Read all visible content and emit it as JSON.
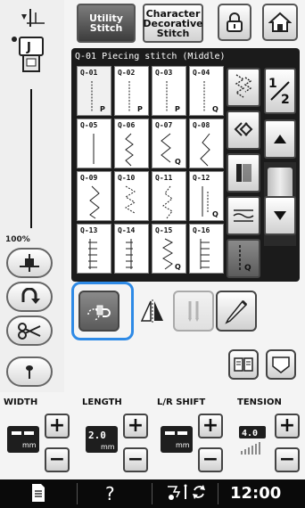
{
  "tabs": {
    "utility": "Utility Stitch",
    "character": "Character Decorative Stitch"
  },
  "panel": {
    "title": "Q-01  Piecing stitch (Middle)"
  },
  "page": {
    "numerator": "1",
    "denominator": "2"
  },
  "stitches": [
    {
      "code": "Q-01",
      "mark": "P"
    },
    {
      "code": "Q-02",
      "mark": "P"
    },
    {
      "code": "Q-03",
      "mark": "P"
    },
    {
      "code": "Q-04",
      "mark": "Q"
    },
    {
      "code": "Q-05",
      "mark": ""
    },
    {
      "code": "Q-06",
      "mark": ""
    },
    {
      "code": "Q-07",
      "mark": "Q"
    },
    {
      "code": "Q-08",
      "mark": ""
    },
    {
      "code": "Q-09",
      "mark": ""
    },
    {
      "code": "Q-10",
      "mark": ""
    },
    {
      "code": "Q-11",
      "mark": ""
    },
    {
      "code": "Q-12",
      "mark": "Q"
    },
    {
      "code": "Q-13",
      "mark": ""
    },
    {
      "code": "Q-14",
      "mark": ""
    },
    {
      "code": "Q-15",
      "mark": "Q"
    },
    {
      "code": "Q-16",
      "mark": ""
    }
  ],
  "zoom": "100%",
  "controls": {
    "width_label": "WIDTH",
    "length_label": "LENGTH",
    "shift_label": "L/R SHIFT",
    "tension_label": "TENSION",
    "width_unit": "mm",
    "length_value": "2.0",
    "length_unit": "mm",
    "shift_unit": "mm",
    "tension_value": "4.0",
    "plus": "+",
    "minus": "−"
  },
  "status": {
    "help": "?",
    "clock": "12:00"
  },
  "colors": {
    "accent": "#2e8ae6",
    "panel": "#1b1b1b"
  },
  "icons": [
    "needle-position-icon",
    "presser-foot-icon",
    "lock-icon",
    "home-icon",
    "reverse-icon",
    "thread-cutter-icon",
    "scissors-icon",
    "needle-stop-icon",
    "pivot-icon",
    "mirror-icon",
    "twin-needle-icon",
    "edit-pencil-icon",
    "manual-icon",
    "pocket-icon",
    "document-icon",
    "thread-lamp-icon",
    "swap-icon"
  ]
}
